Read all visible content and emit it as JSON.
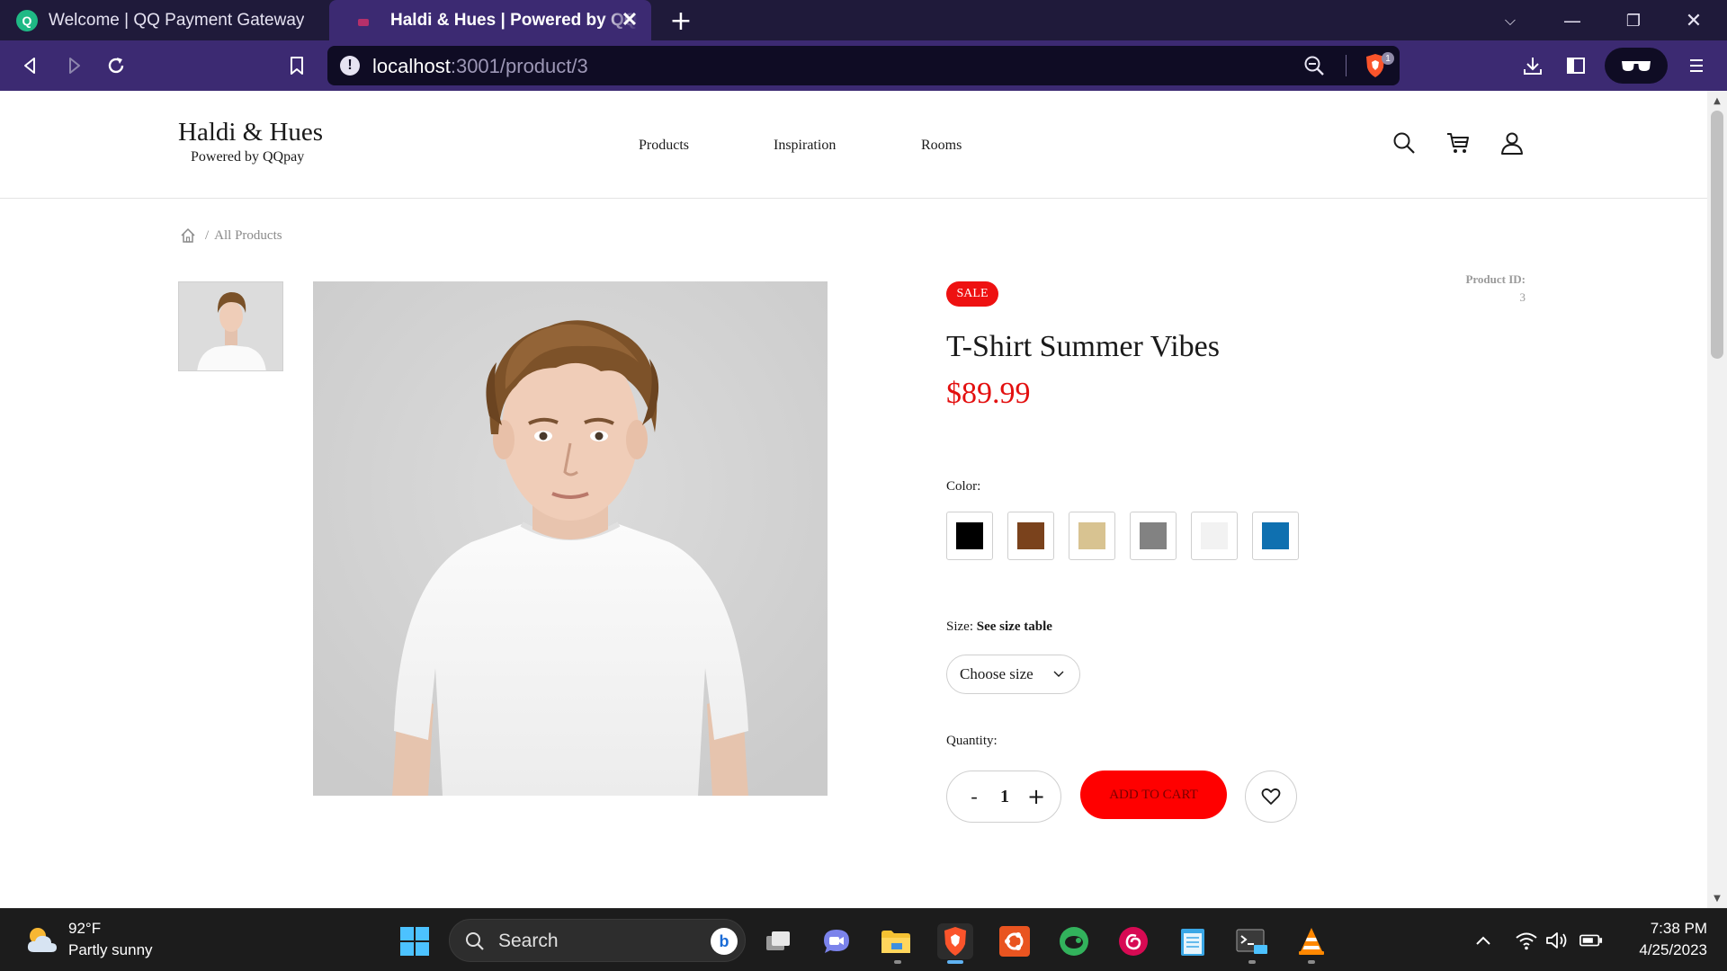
{
  "browser": {
    "tabs": [
      {
        "title": "Welcome | QQ Payment Gateway",
        "favicon": "qq-icon"
      },
      {
        "title": "Haldi & Hues | Powered by QQpay",
        "favicon": "site-icon",
        "active": true
      }
    ],
    "url_host": "localhost",
    "url_path": ":3001/product/3",
    "shield_count": "1"
  },
  "site": {
    "brand_name": "Haldi & Hues",
    "brand_sub": "Powered by QQpay",
    "nav": [
      "Products",
      "Inspiration",
      "Rooms"
    ]
  },
  "breadcrumb": {
    "separator": "/",
    "current": "All Products"
  },
  "product": {
    "badge": "SALE",
    "id_label": "Product ID:",
    "id_value": "3",
    "title": "T-Shirt Summer Vibes",
    "price": "$89.99",
    "color_label": "Color:",
    "colors": [
      "#000000",
      "#7a421c",
      "#d8c391",
      "#828282",
      "#f2f2f2",
      "#0f70b0"
    ],
    "size_label": "Size:",
    "size_table_link": "See size table",
    "size_placeholder": "Choose size",
    "quantity_label": "Quantity:",
    "qty_minus": "-",
    "qty_value": "1",
    "qty_plus": "+",
    "add_to_cart": "ADD TO CART"
  },
  "taskbar": {
    "weather_temp": "92°F",
    "weather_desc": "Partly sunny",
    "search_placeholder": "Search",
    "time": "7:38 PM",
    "date": "4/25/2023"
  }
}
